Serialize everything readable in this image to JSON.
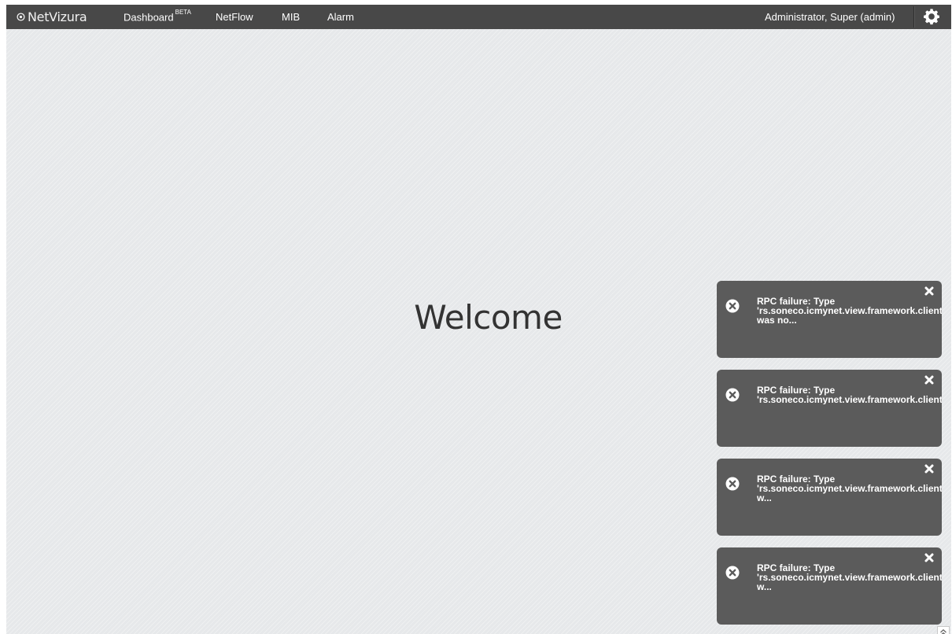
{
  "app": {
    "logo": "NetVizura",
    "logo_icon": "target-icon"
  },
  "nav": {
    "items": [
      {
        "label": "Dashboard",
        "badge": "BETA"
      },
      {
        "label": "NetFlow"
      },
      {
        "label": "MIB"
      },
      {
        "label": "Alarm"
      }
    ]
  },
  "user": {
    "name": "Administrator, Super (admin)",
    "settings_icon": "gear-icon"
  },
  "main": {
    "welcome": "Welcome"
  },
  "notifications": [
    {
      "text": "RPC failure: Type\n'rs.soneco.icmynet.view.framework.client\nwas no..."
    },
    {
      "text": "RPC failure: Type\n'rs.soneco.icmynet.view.framework.client"
    },
    {
      "text": "RPC failure: Type\n'rs.soneco.icmynet.view.framework.client\nw..."
    },
    {
      "text": "RPC failure: Type\n'rs.soneco.icmynet.view.framework.client\nw..."
    }
  ],
  "colors": {
    "topbar": "#484848",
    "background": "#e6e8ea",
    "toast": "#5b5b5b"
  }
}
